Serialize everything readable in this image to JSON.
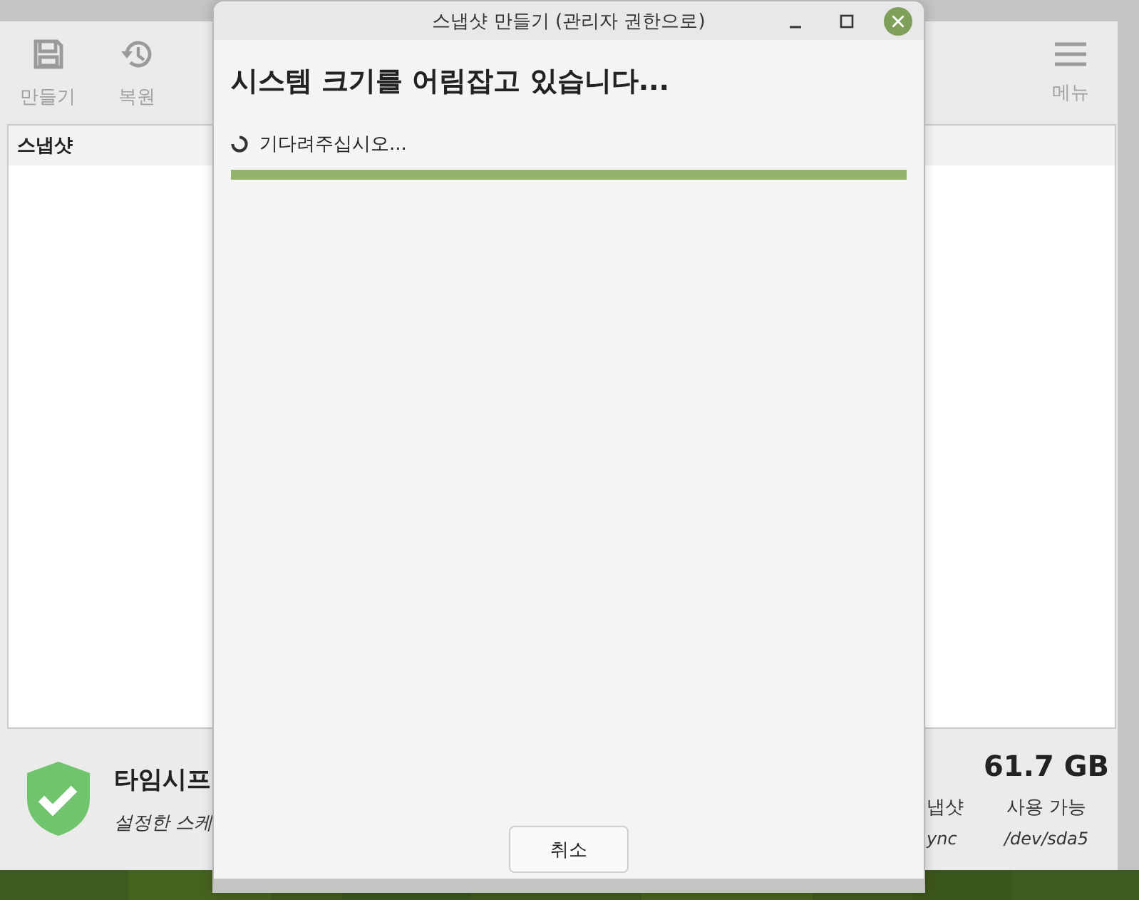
{
  "main_window": {
    "toolbar": [
      {
        "label": "만들기",
        "kind": "save"
      },
      {
        "label": "복원",
        "kind": "restore"
      }
    ],
    "menu_label": "메뉴",
    "table": {
      "columns": [
        "스냅샷"
      ]
    },
    "status": {
      "title": "타임시프",
      "subtitle": "설정한 스케",
      "stats": [
        {
          "label": "냅샷",
          "device": "ync"
        },
        {
          "value": "61.7 GB",
          "label": "사용 가능",
          "device": "/dev/sda5"
        }
      ]
    }
  },
  "dialog": {
    "title": "스냅샷 만들기 (관리자 권한으로)",
    "heading": "시스템 크기를 어림잡고 있습니다...",
    "message": "기다려주십시오...",
    "progress": {
      "level": 1.0
    },
    "buttons": [
      "취소"
    ]
  }
}
